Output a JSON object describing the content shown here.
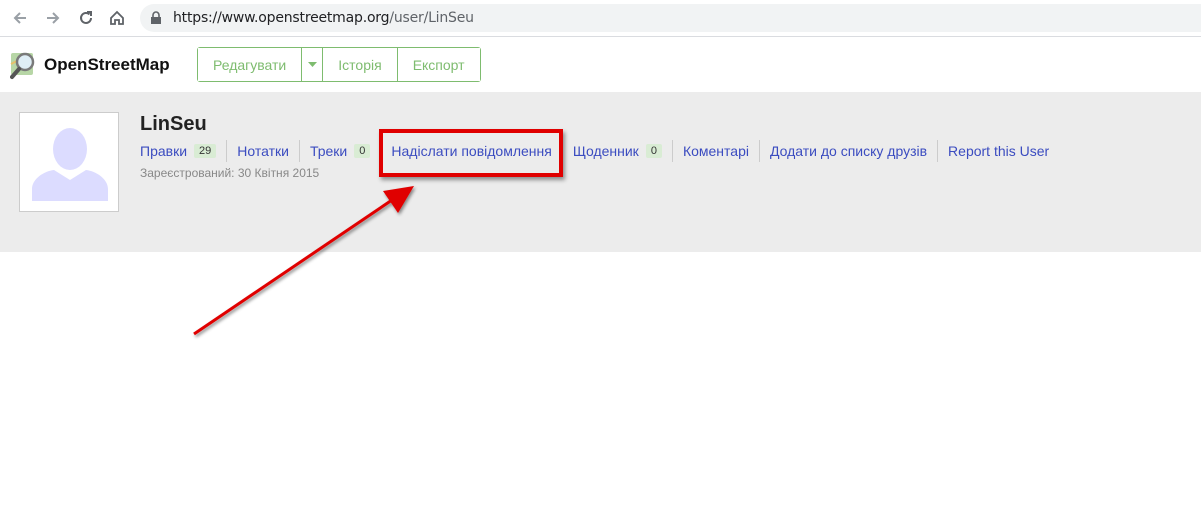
{
  "browser": {
    "url_host": "https://www.openstreetmap.org",
    "url_path": "/user/LinSeu"
  },
  "header": {
    "brand": "OpenStreetMap",
    "buttons": [
      {
        "label": "Редагувати"
      },
      {
        "label": "Історія"
      },
      {
        "label": "Експорт"
      }
    ]
  },
  "profile": {
    "username": "LinSeu",
    "registered": "Зареєстрований: 30 Квітня 2015",
    "links": [
      {
        "label": "Правки",
        "badge": "29"
      },
      {
        "label": "Нотатки"
      },
      {
        "label": "Треки",
        "badge": "0"
      },
      {
        "label": "Надіслати повідомлення"
      },
      {
        "label": "Щоденник",
        "badge": "0"
      },
      {
        "label": "Коментарі"
      },
      {
        "label": "Додати до списку друзів"
      },
      {
        "label": "Report this User"
      }
    ]
  },
  "colors": {
    "osm_green": "#7ebc6f",
    "link_blue": "#3b4cc0",
    "annotation_red": "#e00000"
  }
}
